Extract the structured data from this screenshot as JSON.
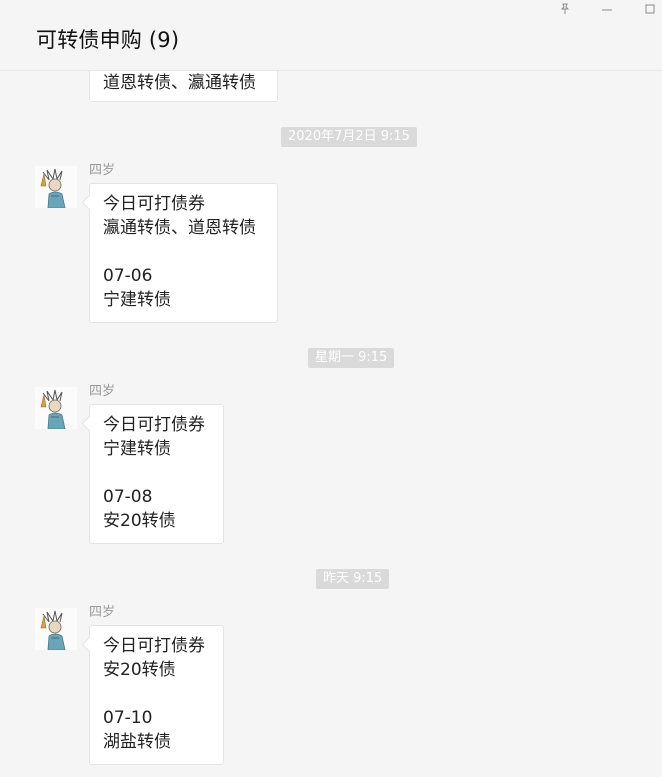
{
  "window": {
    "title": "可转债申购 (9)",
    "controls": {
      "pin_icon": "pin-icon",
      "minimize_icon": "minimize-icon",
      "maximize_icon": "maximize-icon"
    }
  },
  "messages": [
    {
      "partial_text": "道恩转债、瀛通转债"
    },
    {
      "timestamp": "2020年7月2日 9:15",
      "sender": "四岁",
      "text": "今日可打债券\n瀛通转债、道恩转债\n\n07-06\n宁建转债"
    },
    {
      "timestamp": "星期一 9:15",
      "sender": "四岁",
      "text": "今日可打债券\n宁建转债\n\n07-08\n安20转债"
    },
    {
      "timestamp": "昨天 9:15",
      "sender": "四岁",
      "text": "今日可打债券\n安20转债\n\n07-10\n湖盐转债"
    }
  ],
  "colors": {
    "background": "#f5f5f5",
    "bubble": "#ffffff",
    "timestamp_bg": "#dadada",
    "sender_text": "#9a9a9a"
  }
}
